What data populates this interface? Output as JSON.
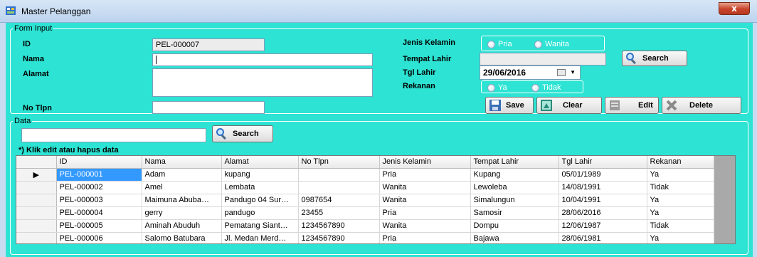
{
  "window": {
    "title": "Master Pelanggan",
    "close_glyph": "x"
  },
  "form_input": {
    "legend": "Form Input",
    "id_label": "ID",
    "id_value": "PEL-000007",
    "nama_label": "Nama",
    "nama_value": "",
    "alamat_label": "Alamat",
    "alamat_value": "",
    "notlpn_label": "No Tlpn",
    "notlpn_value": "",
    "jk_label": "Jenis Kelamin",
    "jk_options": [
      "Pria",
      "Wanita"
    ],
    "tempat_label": "Tempat Lahir",
    "tempat_value": "",
    "search_label": "Search",
    "tgl_label": "Tgl Lahir",
    "tgl_value": "29/06/2016",
    "rekanan_label": "Rekanan",
    "rekanan_options": [
      "Ya",
      "Tidak"
    ],
    "save_label": "Save",
    "clear_label": "Clear",
    "edit_label": "Edit",
    "delete_label": "Delete"
  },
  "data": {
    "legend": "Data",
    "search_value": "",
    "search_label": "Search",
    "note": "*) Klik edit atau hapus data",
    "columns": [
      "ID",
      "Nama",
      "Alamat",
      "No Tlpn",
      "Jenis Kelamin",
      "Tempat Lahir",
      "Tgl Lahir",
      "Rekanan"
    ],
    "rows": [
      [
        "PEL-000001",
        "Adam",
        "kupang",
        "",
        "Pria",
        "Kupang",
        "05/01/1989",
        "Ya"
      ],
      [
        "PEL-000002",
        "Amel",
        "Lembata",
        "",
        "Wanita",
        "Lewoleba",
        "14/08/1991",
        "Tidak"
      ],
      [
        "PEL-000003",
        "Maimuna Abuba…",
        "Pandugo 04 Sur…",
        "0987654",
        "Wanita",
        "Simalungun",
        "10/04/1991",
        "Ya"
      ],
      [
        "PEL-000004",
        "gerry",
        "pandugo",
        "23455",
        "Pria",
        "Samosir",
        "28/06/2016",
        "Ya"
      ],
      [
        "PEL-000005",
        "Aminah Abuduh",
        "Pematang Siant…",
        "1234567890",
        "Wanita",
        "Dompu",
        "12/06/1987",
        "Tidak"
      ],
      [
        "PEL-000006",
        "Salomo Batubara",
        "Jl. Medan Merd…",
        "1234567890",
        "Pria",
        "Bajawa",
        "28/06/1981",
        "Ya"
      ]
    ],
    "current_row_glyph": "▶"
  },
  "colors": {
    "client_bg": "#2de3d3",
    "selection": "#3399ff"
  }
}
